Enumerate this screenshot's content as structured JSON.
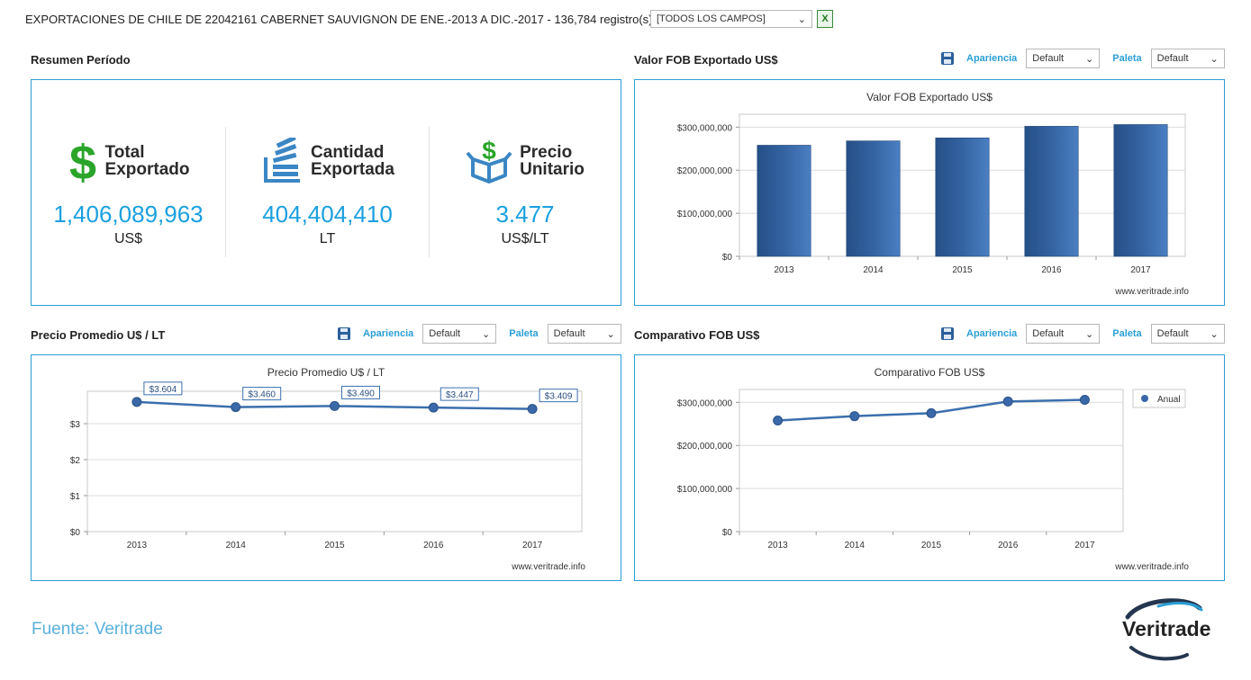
{
  "header": {
    "title": "EXPORTACIONES DE CHILE DE 22042161 CABERNET SAUVIGNON DE ENE.-2013 A DIC.-2017 - 136,784 registro(s)",
    "fields_select": "[TODOS LOS CAMPOS]",
    "excel_icon": "excel-icon"
  },
  "controls": {
    "apariencia_label": "Apariencia",
    "paleta_label": "Paleta",
    "default_value": "Default"
  },
  "summary": {
    "title": "Resumen Período",
    "items": [
      {
        "label_line1": "Total",
        "label_line2": "Exportado",
        "value": "1,406,089,963",
        "unit": "US$",
        "icon": "dollar-icon"
      },
      {
        "label_line1": "Cantidad",
        "label_line2": "Exportada",
        "value": "404,404,410",
        "unit": "LT",
        "icon": "stack-icon"
      },
      {
        "label_line1": "Precio",
        "label_line2": "Unitario",
        "value": "3.477",
        "unit": "US$/LT",
        "icon": "box-dollar-icon"
      }
    ],
    "colors": {
      "value": "#1aa0e0",
      "dollar": "#2aa52a",
      "icons": "#3b86c4"
    }
  },
  "charts": {
    "fob": {
      "section_title": "Valor FOB Exportado US$",
      "watermark": "www.veritrade.info"
    },
    "precio": {
      "section_title": "Precio Promedio U$ / LT",
      "watermark": "www.veritrade.info"
    },
    "comparativo": {
      "section_title": "Comparativo FOB US$",
      "watermark": "www.veritrade.info"
    }
  },
  "chart_data": [
    {
      "type": "bar",
      "title": "Valor FOB Exportado US$",
      "categories": [
        "2013",
        "2014",
        "2015",
        "2016",
        "2017"
      ],
      "values": [
        258000000,
        268000000,
        275000000,
        302000000,
        306000000
      ],
      "ylim": [
        0,
        330000000
      ],
      "yticks": [
        0,
        100000000,
        200000000,
        300000000
      ],
      "ytick_labels": [
        "$0",
        "$100,000,000",
        "$200,000,000",
        "$300,000,000"
      ],
      "grid": true,
      "color": "#2e5f9e"
    },
    {
      "type": "line",
      "title": "Precio Promedio U$ / LT",
      "categories": [
        "2013",
        "2014",
        "2015",
        "2016",
        "2017"
      ],
      "values": [
        3.604,
        3.46,
        3.49,
        3.447,
        3.409
      ],
      "data_labels": [
        "$3.604",
        "$3.460",
        "$3.490",
        "$3.447",
        "$3.409"
      ],
      "ylim": [
        0,
        3.9
      ],
      "yticks": [
        0,
        1,
        2,
        3
      ],
      "ytick_labels": [
        "$0",
        "$1",
        "$2",
        "$3"
      ],
      "grid": true,
      "color": "#3b6fae"
    },
    {
      "type": "line",
      "title": "Comparativo FOB US$",
      "categories": [
        "2013",
        "2014",
        "2015",
        "2016",
        "2017"
      ],
      "series": [
        {
          "name": "Anual",
          "values": [
            258000000,
            268000000,
            275000000,
            302000000,
            306000000
          ]
        }
      ],
      "ylim": [
        0,
        330000000
      ],
      "yticks": [
        0,
        100000000,
        200000000,
        300000000
      ],
      "ytick_labels": [
        "$0",
        "$100,000,000",
        "$200,000,000",
        "$300,000,000"
      ],
      "grid": true,
      "legend": "top-right",
      "color": "#3b6fae"
    }
  ],
  "footer": {
    "source": "Fuente: Veritrade",
    "logo_text": "Veritrade"
  }
}
